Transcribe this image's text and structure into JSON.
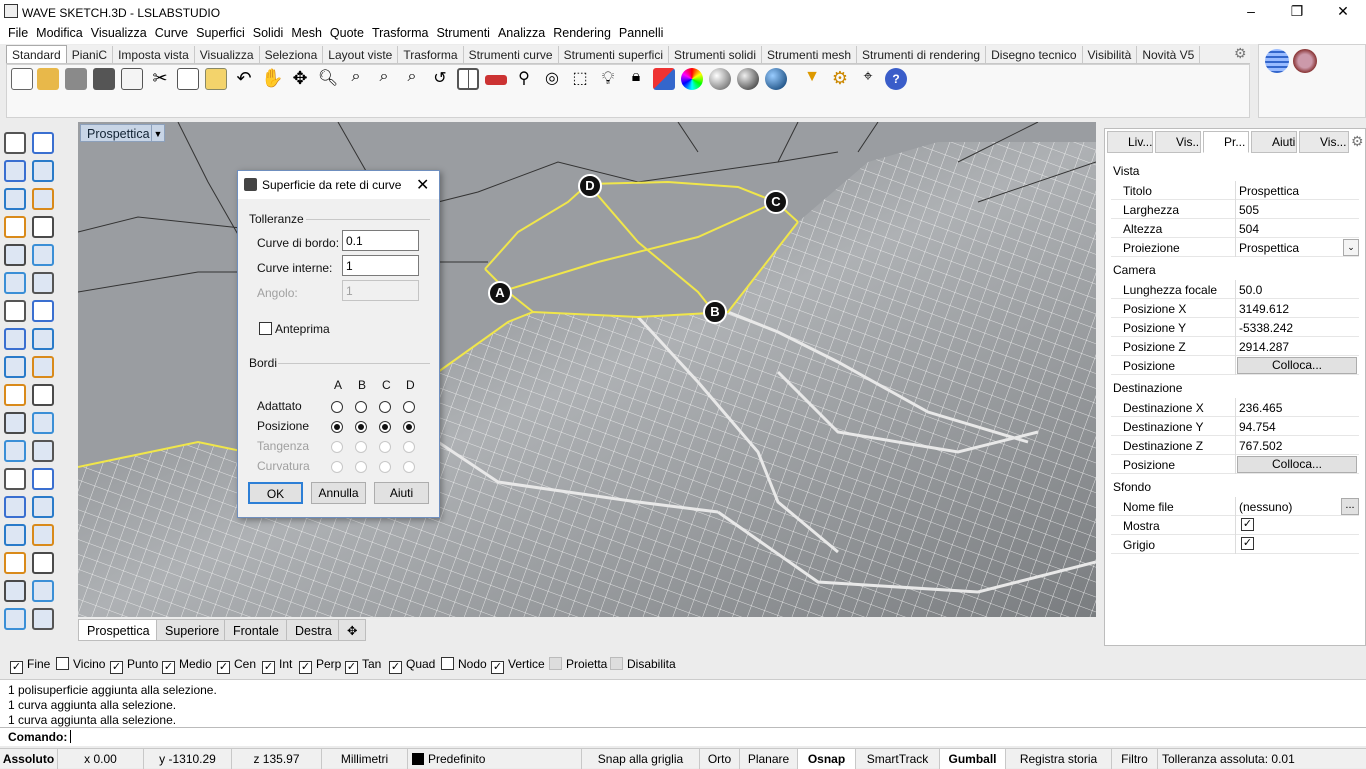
{
  "window": {
    "title": "WAVE SKETCH.3D - LSLABSTUDIO",
    "minimize": "–",
    "restore": "❐",
    "close": "✕"
  },
  "menu": [
    "File",
    "Modifica",
    "Visualizza",
    "Curve",
    "Superfici",
    "Solidi",
    "Mesh",
    "Quote",
    "Trasforma",
    "Strumenti",
    "Analizza",
    "Rendering",
    "Pannelli"
  ],
  "toolbar_tabs": [
    "Standard",
    "PianiC",
    "Imposta vista",
    "Visualizza",
    "Seleziona",
    "Layout viste",
    "Trasforma",
    "Strumenti curve",
    "Strumenti superfici",
    "Strumenti solidi",
    "Strumenti mesh",
    "Strumenti di rendering",
    "Disegno tecnico",
    "Visibilità",
    "Novità V5"
  ],
  "active_tab": "Standard",
  "viewport": {
    "label": "Prospettica",
    "dropdown": "▼"
  },
  "points": {
    "a": "A",
    "b": "B",
    "c": "C",
    "d": "D"
  },
  "view_tabs": [
    "Prospettica",
    "Superiore",
    "Frontale",
    "Destra"
  ],
  "view_add": "✥",
  "dialog": {
    "title": "Superficie da rete di curve",
    "close": "✕",
    "tol_section": "Tolleranze",
    "edge_label": "Curve di bordo:",
    "edge_value": "0.1",
    "inner_label": "Curve interne:",
    "inner_value": "1",
    "angle_label": "Angolo:",
    "angle_value": "1",
    "preview_label": "Anteprima",
    "borders_section": "Bordi",
    "columns": [
      "A",
      "B",
      "C",
      "D"
    ],
    "rows": [
      "Adattato",
      "Posizione",
      "Tangenza",
      "Curvatura"
    ],
    "ok": "OK",
    "cancel": "Annulla",
    "help": "Aiuti"
  },
  "panel_tabs": [
    "Liv...",
    "Vis...",
    "Pr...",
    "Aiuti",
    "Vis..."
  ],
  "properties": {
    "vista_title": "Vista",
    "vista": [
      {
        "k": "Titolo",
        "v": "Prospettica"
      },
      {
        "k": "Larghezza",
        "v": "505"
      },
      {
        "k": "Altezza",
        "v": "504"
      },
      {
        "k": "Proiezione",
        "v": "Prospettica"
      }
    ],
    "camera_title": "Camera",
    "camera": [
      {
        "k": "Lunghezza focale",
        "v": "50.0"
      },
      {
        "k": "Posizione X",
        "v": "3149.612"
      },
      {
        "k": "Posizione Y",
        "v": "-5338.242"
      },
      {
        "k": "Posizione Z",
        "v": "2914.287"
      },
      {
        "k": "Posizione",
        "v": "Colloca..."
      }
    ],
    "dest_title": "Destinazione",
    "dest": [
      {
        "k": "Destinazione X",
        "v": "236.465"
      },
      {
        "k": "Destinazione Y",
        "v": "94.754"
      },
      {
        "k": "Destinazione Z",
        "v": "767.502"
      },
      {
        "k": "Posizione",
        "v": "Colloca..."
      }
    ],
    "sfondo_title": "Sfondo",
    "sfondo": [
      {
        "k": "Nome file",
        "v": "(nessuno)",
        "btn": "..."
      },
      {
        "k": "Mostra",
        "v": "✓"
      },
      {
        "k": "Grigio",
        "v": "✓"
      }
    ]
  },
  "osnaps": [
    {
      "label": "Fine",
      "checked": true
    },
    {
      "label": "Vicino",
      "checked": false
    },
    {
      "label": "Punto",
      "checked": true
    },
    {
      "label": "Medio",
      "checked": true
    },
    {
      "label": "Cen",
      "checked": true
    },
    {
      "label": "Int",
      "checked": true
    },
    {
      "label": "Perp",
      "checked": true
    },
    {
      "label": "Tan",
      "checked": true
    },
    {
      "label": "Quad",
      "checked": true
    },
    {
      "label": "Nodo",
      "checked": false
    },
    {
      "label": "Vertice",
      "checked": true
    },
    {
      "label": "Proietta",
      "checked": false
    },
    {
      "label": "Disabilita",
      "checked": false
    }
  ],
  "history": [
    "1 polisuperficie aggiunta alla selezione.",
    "1 curva aggiunta alla selezione.",
    "1 curva aggiunta alla selezione."
  ],
  "command_label": "Comando:",
  "status": {
    "plane": "Assoluto",
    "x": "x 0.00",
    "y": "y -1310.29",
    "z": "z 135.97",
    "units": "Millimetri",
    "layer": "Predefinito",
    "grid": "Snap alla griglia",
    "ortho": "Orto",
    "planar": "Planare",
    "osnap": "Osnap",
    "smarttrack": "SmartTrack",
    "gumball": "Gumball",
    "history": "Registra storia",
    "filter": "Filtro",
    "tolerance": "Tolleranza assoluta: 0.01"
  },
  "colors": {
    "accent": "#2d7fd6",
    "curve": "#f0e64a",
    "viewport_bg": "#9a9da1"
  }
}
